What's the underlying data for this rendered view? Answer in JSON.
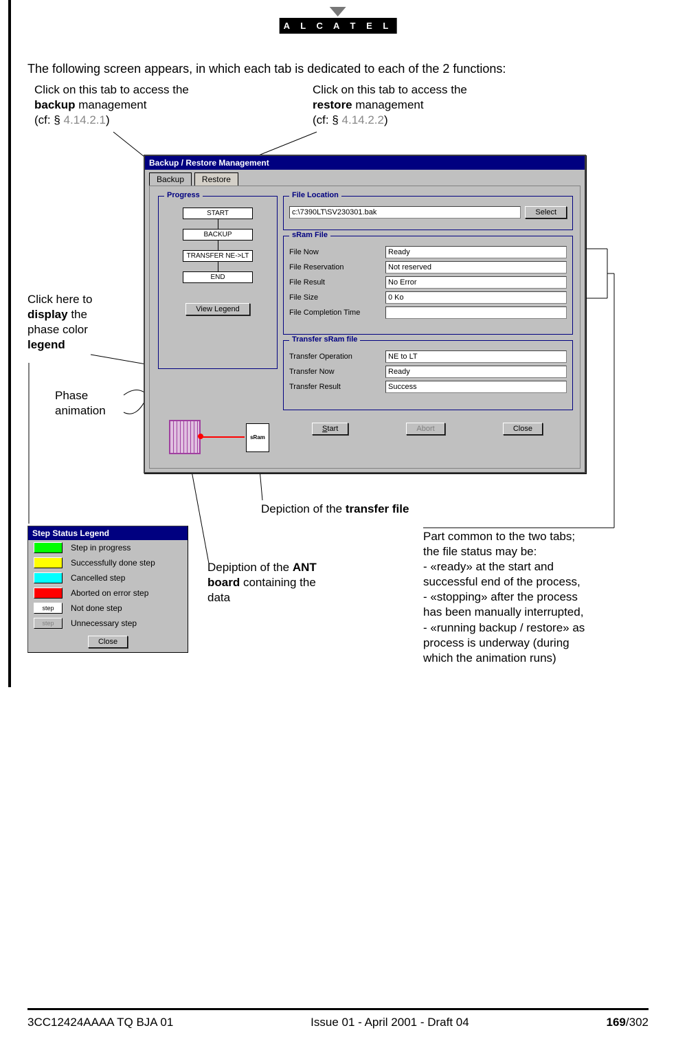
{
  "brand": "A L C A T E L",
  "intro": "The following screen appears, in which each tab is dedicated to each of the 2 functions:",
  "ann_backup_pre": "Click on this tab to access the",
  "ann_backup_bold": "backup",
  "ann_backup_post": " management",
  "ann_backup_ref_pre": "(cf: § ",
  "ann_backup_ref": "4.14.2.1",
  "ann_backup_ref_post": ")",
  "ann_restore_pre": "Click on this tab to access the",
  "ann_restore_bold": "restore",
  "ann_restore_post": " management",
  "ann_restore_ref_pre": "(cf: § ",
  "ann_restore_ref": "4.14.2.2",
  "ann_restore_ref_post": ")",
  "ann_legend_1": "Click here to",
  "ann_legend_bold": "display",
  "ann_legend_2": " the",
  "ann_legend_3": "phase color",
  "ann_legend_bold2": "legend",
  "ann_phase_1": "Phase",
  "ann_phase_2": "animation",
  "ann_transfer_pre": "Depiction of the ",
  "ann_transfer_bold": "transfer file",
  "ann_ant_pre": "Depiption of the ",
  "ann_ant_bold1": "ANT",
  "ann_ant_bold2": "board",
  "ann_ant_post1": " containing the",
  "ann_ant_post2": "data",
  "ann_common_1": "Part common to the two tabs;",
  "ann_common_2": "the file status may be:",
  "ann_common_3": "- «ready» at the start and",
  "ann_common_4": "successful end of the process,",
  "ann_common_5": "- «stopping» after the process",
  "ann_common_6": "has been manually interrupted,",
  "ann_common_7": "- «running backup / restore» as",
  "ann_common_8": "process is underway (during",
  "ann_common_9": "which the animation runs)",
  "win_title": "Backup / Restore Management",
  "tab_backup": "Backup",
  "tab_restore": "Restore",
  "box_progress": "Progress",
  "box_file_location": "File Location",
  "box_sram": "sRam File",
  "box_transfer": "Transfer sRam file",
  "step_start": "START",
  "step_backup": "BACKUP",
  "step_transfer": "TRANSFER NE->LT",
  "step_end": "END",
  "btn_view_legend": "View Legend",
  "file_path": "c:\\7390LT\\SV230301.bak",
  "btn_select": "Select",
  "sram_file_now_label": "File Now",
  "sram_file_now_val": "Ready",
  "sram_file_reservation_label": "File Reservation",
  "sram_file_reservation_val": "Not reserved",
  "sram_file_result_label": "File Result",
  "sram_file_result_val": "No Error",
  "sram_file_size_label": "File Size",
  "sram_file_size_val": "0 Ko",
  "sram_file_completion_label": "File Completion Time",
  "sram_file_completion_val": "",
  "tr_operation_label": "Transfer Operation",
  "tr_operation_val": "NE to LT",
  "tr_now_label": "Transfer Now",
  "tr_now_val": "Ready",
  "tr_result_label": "Transfer Result",
  "tr_result_val": "Success",
  "btn_start": "Start",
  "btn_abort": "Abort",
  "btn_close": "Close",
  "file_icon_label": "sRam",
  "legend_title": "Step Status Legend",
  "legend_green": "Step in progress",
  "legend_yellow": "Successfully done step",
  "legend_cyan": "Cancelled step",
  "legend_red": "Aborted on error step",
  "legend_white": "Not done step",
  "legend_white_swatch": "step",
  "legend_grey": "Unnecessary step",
  "legend_grey_swatch": "step",
  "legend_close": "Close",
  "footer_left": "3CC12424AAAA TQ BJA 01",
  "footer_center": "Issue 01 - April 2001 - Draft 04",
  "footer_page_bold": "169",
  "footer_page_rest": "/302"
}
